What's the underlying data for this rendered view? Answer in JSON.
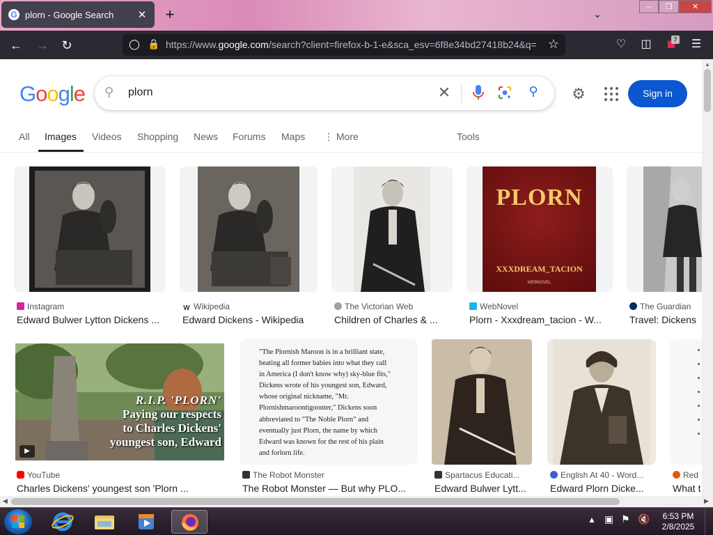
{
  "browser": {
    "tab_title": "plorn - Google Search",
    "tab_close": "✕",
    "new_tab": "+",
    "url_prefix": "https://www.",
    "url_host": "google.com",
    "url_rest": "/search?client=firefox-b-1-e&sca_esv=6f8e34bd27418b24&q=",
    "extension_badge": "7"
  },
  "search": {
    "query": "plorn",
    "signin_label": "Sign in",
    "tabs": [
      "All",
      "Images",
      "Videos",
      "Shopping",
      "News",
      "Forums",
      "Maps",
      "More",
      "Tools"
    ],
    "active_tab": "Images"
  },
  "results_row1": [
    {
      "source": "Instagram",
      "title": "Edward Bulwer Lytton Dickens ...",
      "fav_color": "#d6249f"
    },
    {
      "source": "Wikipedia",
      "title": "Edward Dickens - Wikipedia",
      "fav_color": "#333333"
    },
    {
      "source": "The Victorian Web",
      "title": "Children of Charles & ...",
      "fav_color": "#9aa0a6"
    },
    {
      "source": "WebNovel",
      "title": "Plorn - Xxxdream_tacion - W...",
      "fav_color": "#1ab7ea"
    },
    {
      "source": "The Guardian",
      "title": "Travel: Dickens",
      "fav_color": "#052962"
    }
  ],
  "results_row2": [
    {
      "source": "YouTube",
      "title": "Charles Dickens' youngest son 'Plorn ...",
      "fav_color": "#ff0000"
    },
    {
      "source": "The Robot Monster",
      "title": "The Robot Monster — But why PLO...",
      "fav_color": "#333333"
    },
    {
      "source": "Spartacus Educati...",
      "title": "Edward Bulwer Lytt...",
      "fav_color": "#333333"
    },
    {
      "source": "English At 40 - Word...",
      "title": "Edward Plorn Dicke...",
      "fav_color": "#3b5bdb"
    },
    {
      "source": "Red",
      "title": "What t",
      "fav_color": "#e8590c"
    }
  ],
  "book_cover": {
    "title": "PLORN",
    "author": "XXXDREAM_TACION",
    "brand": "WEBNOVEL"
  },
  "youtube_overlay": {
    "line1": "R.I.P. 'PLORN'",
    "line2": "Paying our respects",
    "line3": "to Charles Dickens'",
    "line4": "youngest son, Edward"
  },
  "robot_text": {
    "lines": [
      "\"The Plornish Maroon is in a brilliant state,",
      "beating all former babies into what they call",
      "in America (I don't know why) sky-blue fits,\"",
      "Dickens wrote of his youngest son, Edward,",
      "whose original nickname, \"Mr.",
      "Plornishmaroontigoonter,\" Dickens soon",
      "abbreviated to \"The Noble Plorn\" and",
      "eventually just Plorn, the name by which",
      "Edward was known for the rest of his plain",
      "and forlorn life."
    ]
  },
  "taskbar": {
    "time": "6:53 PM",
    "date": "2/8/2025"
  }
}
